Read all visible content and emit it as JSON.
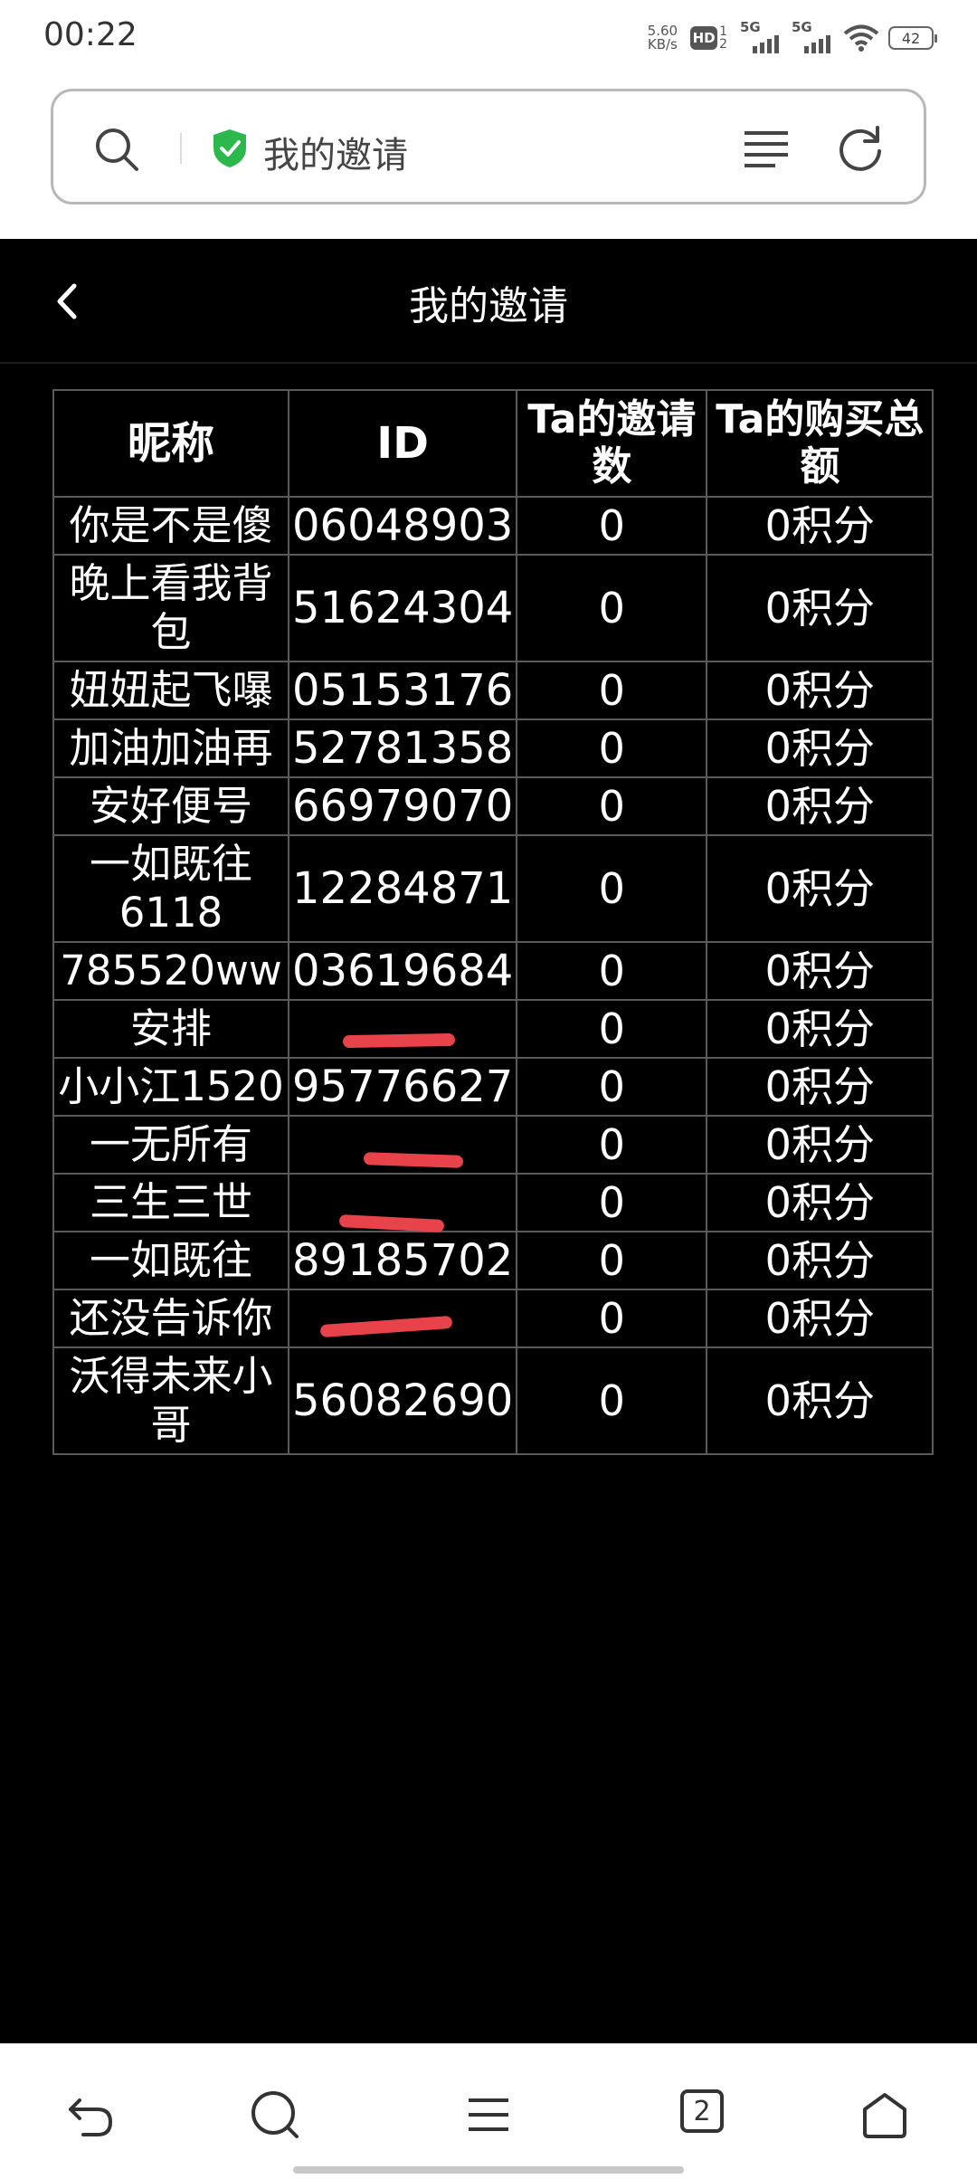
{
  "status_bar": {
    "time": "00:22",
    "net_speed_value": "5.60",
    "net_speed_unit": "KB/s",
    "hd_label": "HD",
    "hd_sub_top": "1",
    "hd_sub_bottom": "2",
    "signal1_label": "5G",
    "signal2_label": "5G",
    "battery": "42"
  },
  "browser": {
    "address_text": "我的邀请",
    "secure_color": "#2db84d",
    "icons": [
      "search-icon",
      "shield-check-icon",
      "menu-lines-icon",
      "reload-icon"
    ]
  },
  "page": {
    "title": "我的邀请",
    "back_icon": "chevron-left-icon"
  },
  "table": {
    "headers": [
      "昵称",
      "ID",
      "Ta的邀请数",
      "Ta的购买总额"
    ],
    "redaction_color": "#e8424b",
    "rows": [
      {
        "nickname": "你是不是傻",
        "id": "06048903",
        "invites": "0",
        "total": "0积分"
      },
      {
        "nickname": "晚上看我背包",
        "id": "51624304",
        "invites": "0",
        "total": "0积分"
      },
      {
        "nickname": "妞妞起飞嚗",
        "id": "05153176",
        "invites": "0",
        "total": "0积分"
      },
      {
        "nickname": "加油加油再",
        "id": "52781358",
        "invites": "0",
        "total": "0积分"
      },
      {
        "nickname": "安好便号",
        "id": "66979070",
        "invites": "0",
        "total": "0积分"
      },
      {
        "nickname": "一如既往6118",
        "id": "12284871",
        "invites": "0",
        "total": "0积分"
      },
      {
        "nickname": "785520ww",
        "id": "03619684",
        "invites": "0",
        "total": "0积分"
      },
      {
        "nickname": "安排",
        "id": "",
        "id_redacted": true,
        "invites": "0",
        "total": "0积分"
      },
      {
        "nickname": "小小江1520",
        "id": "95776627",
        "invites": "0",
        "total": "0积分"
      },
      {
        "nickname": "一无所有",
        "id": "",
        "id_redacted": true,
        "invites": "0",
        "total": "0积分"
      },
      {
        "nickname": "三生三世",
        "id": "",
        "id_redacted": true,
        "invites": "0",
        "total": "0积分"
      },
      {
        "nickname": "一如既往",
        "id": "89185702",
        "invites": "0",
        "total": "0积分"
      },
      {
        "nickname": "还没告诉你",
        "id": "",
        "id_redacted": true,
        "invites": "0",
        "total": "0积分"
      },
      {
        "nickname": "沃得未来小哥",
        "id": "56082690",
        "invites": "0",
        "total": "0积分"
      }
    ]
  },
  "bottom_nav": {
    "tab_count": "2",
    "icons": [
      "back-arrow-icon",
      "search-icon",
      "menu-icon",
      "tabs-icon",
      "home-icon"
    ]
  }
}
